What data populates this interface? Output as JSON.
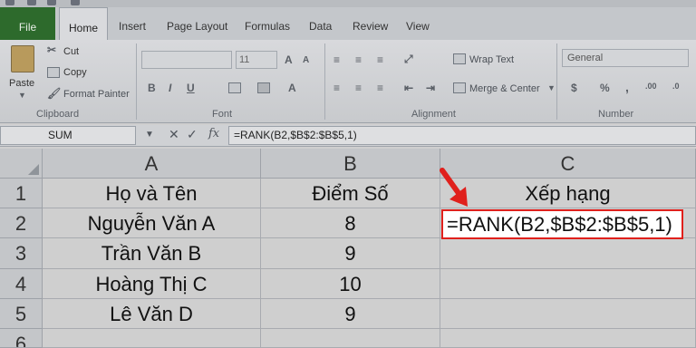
{
  "ribbon": {
    "tabs": [
      "File",
      "Home",
      "Insert",
      "Page Layout",
      "Formulas",
      "Data",
      "Review",
      "View"
    ],
    "clipboard": {
      "paste": "Paste",
      "cut": "Cut",
      "copy": "Copy",
      "format_painter": "Format Painter",
      "label": "Clipboard"
    },
    "font": {
      "size": "11",
      "label": "Font"
    },
    "alignment": {
      "wrap_text": "Wrap Text",
      "merge_center": "Merge & Center",
      "label": "Alignment"
    },
    "number": {
      "format": "General",
      "label": "Number"
    }
  },
  "formula_bar": {
    "name_box": "SUM",
    "formula": "=RANK(B2,$B$2:$B$5,1)",
    "fx": "fx"
  },
  "sheet": {
    "columns": [
      "A",
      "B",
      "C"
    ],
    "rows": [
      {
        "num": "1",
        "a": "Họ và Tên",
        "b": "Điểm Số",
        "c": "Xếp hạng"
      },
      {
        "num": "2",
        "a": "Nguyễn Văn A",
        "b": "8",
        "c": "=RANK(B2,$B$2:$B$5,1)"
      },
      {
        "num": "3",
        "a": "Trần Văn B",
        "b": "9",
        "c": ""
      },
      {
        "num": "4",
        "a": "Hoàng Thị C",
        "b": "10",
        "c": ""
      },
      {
        "num": "5",
        "a": "Lê Văn D",
        "b": "9",
        "c": ""
      },
      {
        "num": "6",
        "a": "",
        "b": "",
        "c": ""
      }
    ]
  },
  "colors": {
    "accent_red": "#e0201c",
    "file_tab": "#2d6a2c"
  }
}
